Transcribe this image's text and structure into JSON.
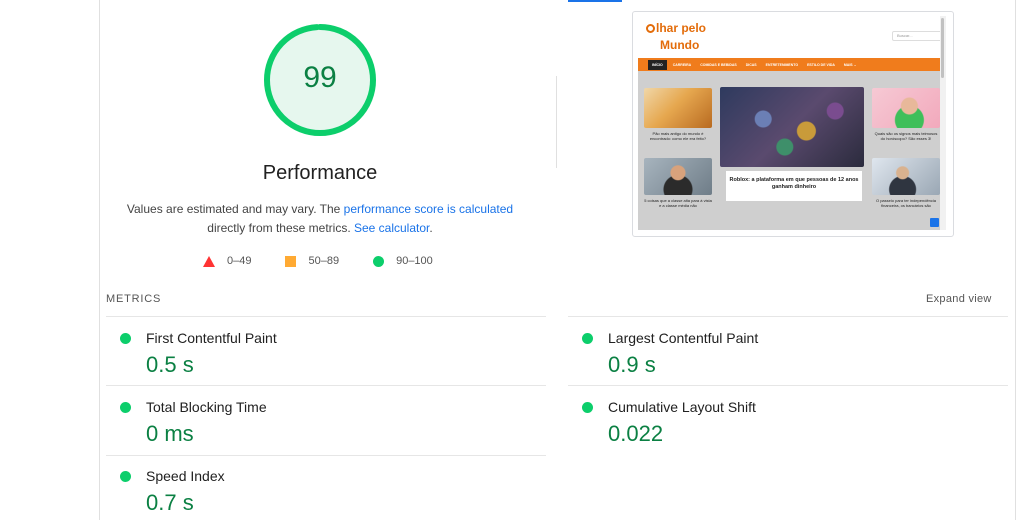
{
  "gauge": {
    "score": "99",
    "score_fraction": 0.99,
    "color": "#0cce6b",
    "fill": "#e6f7ee",
    "text_color": "#0b8043"
  },
  "performance": {
    "title": "Performance",
    "desc_prefix": "Values are estimated and may vary. The ",
    "desc_link1": "performance score is calculated",
    "desc_middle": "directly from these metrics. ",
    "desc_link2": "See calculator",
    "desc_suffix": "."
  },
  "legend": [
    {
      "shape": "triangle",
      "label": "0–49",
      "color": "#ff3333"
    },
    {
      "shape": "square",
      "label": "50–89",
      "color": "#ffaa33"
    },
    {
      "shape": "circle",
      "label": "90–100",
      "color": "#0cce6b"
    }
  ],
  "thumbnail": {
    "logo_line1": "lhar pelo",
    "logo_line2": "Mundo",
    "search_placeholder": "Buscar...",
    "nav": [
      "INÍCIO",
      "CARREIRA",
      "COMIDAS E BEBIDAS",
      "DICAS",
      "ENTRETENIMENTO",
      "ESTILO DE VIDA",
      "MAIS ⌄"
    ],
    "cards": [
      {
        "caption": "Pão mais antigo do mundo é encontrado: como ele era feito?"
      },
      {
        "caption": "Quais são os signos mais teimosos do horóscopo? São esses 3!"
      },
      {
        "caption": "5 coisas que a classe alta para à vista e a classe média não"
      },
      {
        "caption": "O passeio para ter independência financeira, os bancários são"
      }
    ],
    "feature_caption": "Roblox: a plataforma em que pessoas de 12 anos ganham dinheiro",
    "brand_color": "#e36c0a"
  },
  "metrics": {
    "heading": "METRICS",
    "expand_label": "Expand view",
    "items": [
      {
        "name": "First Contentful Paint",
        "value": "0.5 s"
      },
      {
        "name": "Largest Contentful Paint",
        "value": "0.9 s"
      },
      {
        "name": "Total Blocking Time",
        "value": "0 ms"
      },
      {
        "name": "Cumulative Layout Shift",
        "value": "0.022"
      },
      {
        "name": "Speed Index",
        "value": "0.7 s"
      }
    ],
    "good_color": "#0cce6b",
    "value_color": "#0b8043"
  }
}
